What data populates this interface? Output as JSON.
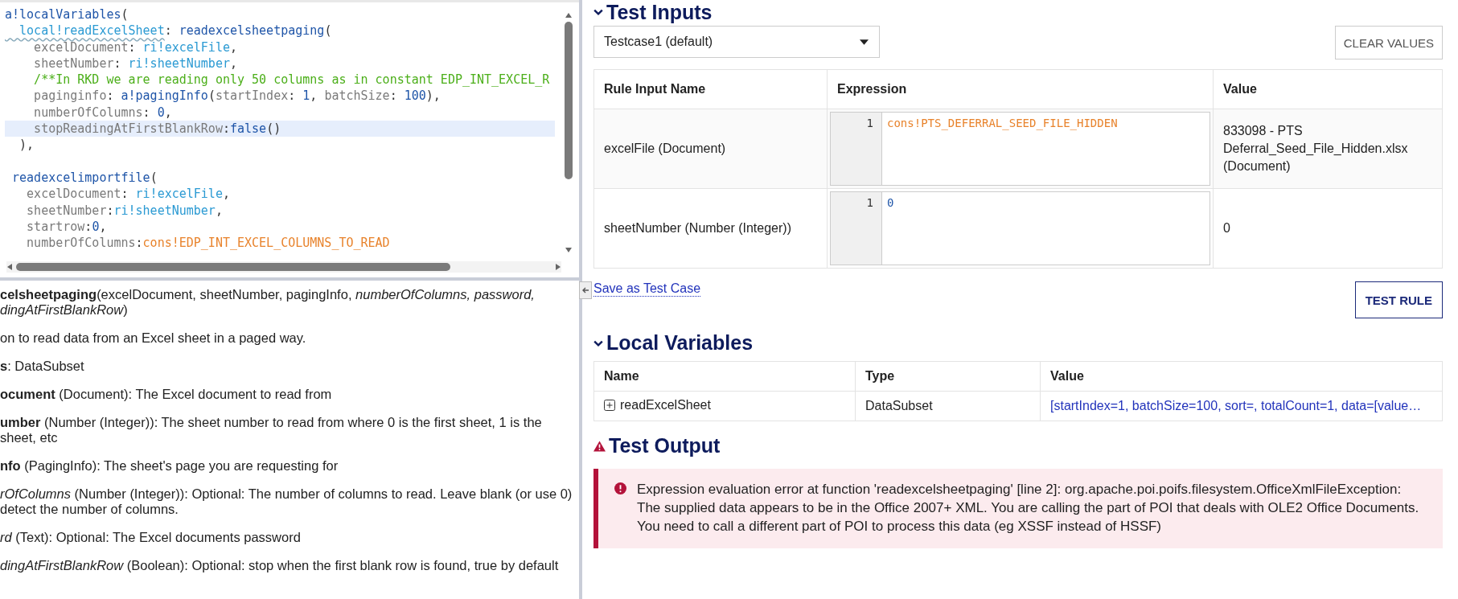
{
  "editor": {
    "lines": [
      {
        "selected": false,
        "tokens": [
          {
            "kind": "fn",
            "text": "a!localVariables"
          },
          {
            "kind": "punct",
            "text": "("
          }
        ]
      },
      {
        "selected": false,
        "tokens": [
          {
            "kind": "local",
            "text": "  local!readExcelSheet"
          },
          {
            "kind": "punct",
            "text": ": "
          },
          {
            "kind": "fn",
            "text": "readexcelsheetpaging"
          },
          {
            "kind": "punct",
            "text": "("
          }
        ]
      },
      {
        "selected": false,
        "tokens": [
          {
            "kind": "key",
            "text": "    excelDocument"
          },
          {
            "kind": "punct",
            "text": ": "
          },
          {
            "kind": "ri",
            "text": "ri!excelFile"
          },
          {
            "kind": "punct",
            "text": ","
          }
        ]
      },
      {
        "selected": false,
        "tokens": [
          {
            "kind": "key",
            "text": "    sheetNumber"
          },
          {
            "kind": "punct",
            "text": ": "
          },
          {
            "kind": "ri",
            "text": "ri!sheetNumber"
          },
          {
            "kind": "punct",
            "text": ","
          }
        ]
      },
      {
        "selected": false,
        "tokens": [
          {
            "kind": "comment",
            "text": "    /**In RKD we are reading only 50 columns as in constant EDP_INT_EXCEL_R"
          }
        ]
      },
      {
        "selected": false,
        "tokens": [
          {
            "kind": "key",
            "text": "    paginginfo"
          },
          {
            "kind": "punct",
            "text": ": "
          },
          {
            "kind": "fn",
            "text": "a!pagingInfo"
          },
          {
            "kind": "punct",
            "text": "("
          },
          {
            "kind": "key",
            "text": "startIndex"
          },
          {
            "kind": "punct",
            "text": ": "
          },
          {
            "kind": "num",
            "text": "1"
          },
          {
            "kind": "punct",
            "text": ", "
          },
          {
            "kind": "key",
            "text": "batchSize"
          },
          {
            "kind": "punct",
            "text": ": "
          },
          {
            "kind": "num",
            "text": "100"
          },
          {
            "kind": "punct",
            "text": "),"
          }
        ]
      },
      {
        "selected": false,
        "tokens": [
          {
            "kind": "key",
            "text": "    numberOfColumns"
          },
          {
            "kind": "punct",
            "text": ": "
          },
          {
            "kind": "num",
            "text": "0"
          },
          {
            "kind": "punct",
            "text": ","
          }
        ]
      },
      {
        "selected": true,
        "tokens": [
          {
            "kind": "key",
            "text": "    stopReadingAtFirstBlankRow"
          },
          {
            "kind": "punct",
            "text": ":"
          },
          {
            "kind": "fn",
            "text": "false"
          },
          {
            "kind": "punct",
            "text": "()"
          }
        ]
      },
      {
        "selected": false,
        "tokens": [
          {
            "kind": "punct",
            "text": "  ),"
          }
        ]
      },
      {
        "selected": false
      },
      {
        "selected": false,
        "tokens": [
          {
            "kind": "fn",
            "text": " readexcelimportfile"
          },
          {
            "kind": "punct",
            "text": "("
          }
        ]
      },
      {
        "selected": false,
        "tokens": [
          {
            "kind": "key",
            "text": "   excelDocument"
          },
          {
            "kind": "punct",
            "text": ": "
          },
          {
            "kind": "ri",
            "text": "ri!excelFile"
          },
          {
            "kind": "punct",
            "text": ","
          }
        ]
      },
      {
        "selected": false,
        "tokens": [
          {
            "kind": "key",
            "text": "   sheetNumber"
          },
          {
            "kind": "punct",
            "text": ":"
          },
          {
            "kind": "ri",
            "text": "ri!sheetNumber"
          },
          {
            "kind": "punct",
            "text": ","
          }
        ]
      },
      {
        "selected": false,
        "tokens": [
          {
            "kind": "key",
            "text": "   startrow"
          },
          {
            "kind": "punct",
            "text": ":"
          },
          {
            "kind": "num",
            "text": "0"
          },
          {
            "kind": "punct",
            "text": ","
          }
        ]
      },
      {
        "selected": false,
        "tokens": [
          {
            "kind": "key",
            "text": "   numberOfColumns"
          },
          {
            "kind": "punct",
            "text": ":"
          },
          {
            "kind": "cons",
            "text": "cons!EDP_INT_EXCEL_COLUMNS_TO_READ"
          }
        ]
      }
    ]
  },
  "help": {
    "paragraphs": [
      [
        "**celsheetpaging**(excelDocument, sheetNumber, pagingInfo, *numberOfColumns, password,*",
        "*dingAtFirstBlankRow*)"
      ],
      [
        "on to read data from an Excel sheet in a paged way."
      ],
      [
        "**s**: DataSubset"
      ],
      [
        "**ocument** (Document): The Excel document to read from"
      ],
      [
        "**umber** (Number (Integer)): The sheet number to read from where 0 is the first sheet, 1 is the",
        "sheet, etc"
      ],
      [
        "**nfo** (PagingInfo): The sheet's page you are requesting for"
      ],
      [
        "*rOfColumns* (Number (Integer)): Optional: The number of columns to read. Leave blank (or use 0)",
        "detect the number of columns."
      ],
      [
        "*rd* (Text): Optional: The Excel documents password"
      ],
      [
        "*dingAtFirstBlankRow* (Boolean): Optional: stop when the first blank row is found, true by default"
      ]
    ]
  },
  "test_inputs": {
    "title": "Test Inputs",
    "expanded": true,
    "testcase": "Testcase1 (default)",
    "clear_button": "CLEAR VALUES",
    "columns": [
      "Rule Input Name",
      "Expression",
      "Value"
    ],
    "rows": [
      {
        "name": "excelFile (Document)",
        "line_number": "1",
        "expression": {
          "kind": "cons",
          "text": "cons!PTS_DEFERRAL_SEED_FILE_HIDDEN"
        },
        "value": [
          "833098 - PTS",
          "Deferral_Seed_File_Hidden.xlsx",
          "(Document)"
        ]
      },
      {
        "name": "sheetNumber (Number (Integer))",
        "line_number": "1",
        "expression": {
          "kind": "num",
          "text": "0"
        },
        "value": [
          "0"
        ]
      }
    ],
    "save_link": "Save as Test Case",
    "test_button": "TEST RULE"
  },
  "local_variables": {
    "title": "Local Variables",
    "expanded": true,
    "columns": [
      "Name",
      "Type",
      "Value"
    ],
    "rows": [
      {
        "name": "readExcelSheet",
        "expanded": false,
        "type": "DataSubset",
        "value": "[startIndex=1, batchSize=100, sort=, totalCount=1, data=[value…"
      }
    ]
  },
  "test_output": {
    "title": "Test Output",
    "kind": "error",
    "message": "Expression evaluation error at function 'readexcelsheetpaging' [line 2]: org.apache.poi.poifs.filesystem.OfficeXmlFileException: The supplied data appears to be in the Office 2007+ XML. You are calling the part of POI that deals with OLE2 Office Documents. You need to call a different part of POI to process this data (eg XSSF instead of HSSF)"
  }
}
